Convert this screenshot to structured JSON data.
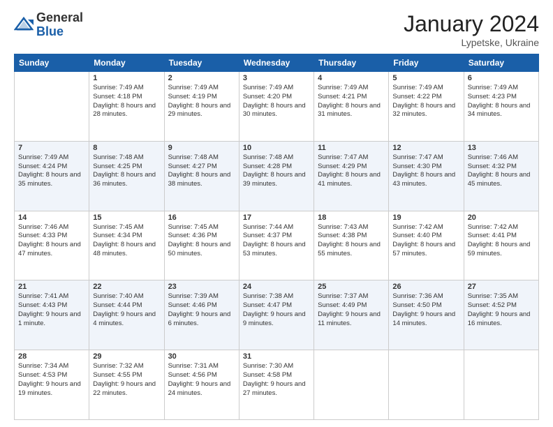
{
  "header": {
    "logo_general": "General",
    "logo_blue": "Blue",
    "month_title": "January 2024",
    "location": "Lypetske, Ukraine"
  },
  "days_of_week": [
    "Sunday",
    "Monday",
    "Tuesday",
    "Wednesday",
    "Thursday",
    "Friday",
    "Saturday"
  ],
  "weeks": [
    [
      {
        "day": "",
        "sunrise": "",
        "sunset": "",
        "daylight": "",
        "empty": true
      },
      {
        "day": "1",
        "sunrise": "7:49 AM",
        "sunset": "4:18 PM",
        "daylight": "8 hours and 28 minutes."
      },
      {
        "day": "2",
        "sunrise": "7:49 AM",
        "sunset": "4:19 PM",
        "daylight": "8 hours and 29 minutes."
      },
      {
        "day": "3",
        "sunrise": "7:49 AM",
        "sunset": "4:20 PM",
        "daylight": "8 hours and 30 minutes."
      },
      {
        "day": "4",
        "sunrise": "7:49 AM",
        "sunset": "4:21 PM",
        "daylight": "8 hours and 31 minutes."
      },
      {
        "day": "5",
        "sunrise": "7:49 AM",
        "sunset": "4:22 PM",
        "daylight": "8 hours and 32 minutes."
      },
      {
        "day": "6",
        "sunrise": "7:49 AM",
        "sunset": "4:23 PM",
        "daylight": "8 hours and 34 minutes."
      }
    ],
    [
      {
        "day": "7",
        "sunrise": "7:49 AM",
        "sunset": "4:24 PM",
        "daylight": "8 hours and 35 minutes."
      },
      {
        "day": "8",
        "sunrise": "7:48 AM",
        "sunset": "4:25 PM",
        "daylight": "8 hours and 36 minutes."
      },
      {
        "day": "9",
        "sunrise": "7:48 AM",
        "sunset": "4:27 PM",
        "daylight": "8 hours and 38 minutes."
      },
      {
        "day": "10",
        "sunrise": "7:48 AM",
        "sunset": "4:28 PM",
        "daylight": "8 hours and 39 minutes."
      },
      {
        "day": "11",
        "sunrise": "7:47 AM",
        "sunset": "4:29 PM",
        "daylight": "8 hours and 41 minutes."
      },
      {
        "day": "12",
        "sunrise": "7:47 AM",
        "sunset": "4:30 PM",
        "daylight": "8 hours and 43 minutes."
      },
      {
        "day": "13",
        "sunrise": "7:46 AM",
        "sunset": "4:32 PM",
        "daylight": "8 hours and 45 minutes."
      }
    ],
    [
      {
        "day": "14",
        "sunrise": "7:46 AM",
        "sunset": "4:33 PM",
        "daylight": "8 hours and 47 minutes."
      },
      {
        "day": "15",
        "sunrise": "7:45 AM",
        "sunset": "4:34 PM",
        "daylight": "8 hours and 48 minutes."
      },
      {
        "day": "16",
        "sunrise": "7:45 AM",
        "sunset": "4:36 PM",
        "daylight": "8 hours and 50 minutes."
      },
      {
        "day": "17",
        "sunrise": "7:44 AM",
        "sunset": "4:37 PM",
        "daylight": "8 hours and 53 minutes."
      },
      {
        "day": "18",
        "sunrise": "7:43 AM",
        "sunset": "4:38 PM",
        "daylight": "8 hours and 55 minutes."
      },
      {
        "day": "19",
        "sunrise": "7:42 AM",
        "sunset": "4:40 PM",
        "daylight": "8 hours and 57 minutes."
      },
      {
        "day": "20",
        "sunrise": "7:42 AM",
        "sunset": "4:41 PM",
        "daylight": "8 hours and 59 minutes."
      }
    ],
    [
      {
        "day": "21",
        "sunrise": "7:41 AM",
        "sunset": "4:43 PM",
        "daylight": "9 hours and 1 minute."
      },
      {
        "day": "22",
        "sunrise": "7:40 AM",
        "sunset": "4:44 PM",
        "daylight": "9 hours and 4 minutes."
      },
      {
        "day": "23",
        "sunrise": "7:39 AM",
        "sunset": "4:46 PM",
        "daylight": "9 hours and 6 minutes."
      },
      {
        "day": "24",
        "sunrise": "7:38 AM",
        "sunset": "4:47 PM",
        "daylight": "9 hours and 9 minutes."
      },
      {
        "day": "25",
        "sunrise": "7:37 AM",
        "sunset": "4:49 PM",
        "daylight": "9 hours and 11 minutes."
      },
      {
        "day": "26",
        "sunrise": "7:36 AM",
        "sunset": "4:50 PM",
        "daylight": "9 hours and 14 minutes."
      },
      {
        "day": "27",
        "sunrise": "7:35 AM",
        "sunset": "4:52 PM",
        "daylight": "9 hours and 16 minutes."
      }
    ],
    [
      {
        "day": "28",
        "sunrise": "7:34 AM",
        "sunset": "4:53 PM",
        "daylight": "9 hours and 19 minutes."
      },
      {
        "day": "29",
        "sunrise": "7:32 AM",
        "sunset": "4:55 PM",
        "daylight": "9 hours and 22 minutes."
      },
      {
        "day": "30",
        "sunrise": "7:31 AM",
        "sunset": "4:56 PM",
        "daylight": "9 hours and 24 minutes."
      },
      {
        "day": "31",
        "sunrise": "7:30 AM",
        "sunset": "4:58 PM",
        "daylight": "9 hours and 27 minutes."
      },
      {
        "day": "",
        "sunrise": "",
        "sunset": "",
        "daylight": "",
        "empty": true
      },
      {
        "day": "",
        "sunrise": "",
        "sunset": "",
        "daylight": "",
        "empty": true
      },
      {
        "day": "",
        "sunrise": "",
        "sunset": "",
        "daylight": "",
        "empty": true
      }
    ]
  ],
  "labels": {
    "sunrise": "Sunrise:",
    "sunset": "Sunset:",
    "daylight": "Daylight:"
  }
}
